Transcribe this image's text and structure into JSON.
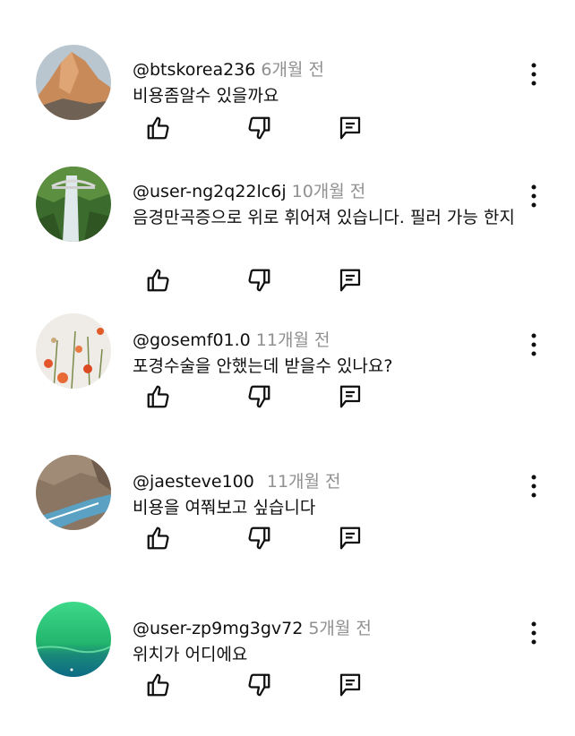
{
  "comments": [
    {
      "handle": "@btskorea236",
      "time": "6개월 전",
      "text": "비용좀알수 있을까요"
    },
    {
      "handle": "@user-ng2q22lc6j",
      "time": "10개월 전",
      "text": "음경만곡증으로 위로 휘어져 있습니다. 필러 가능 한지"
    },
    {
      "handle": "@gosemf01.0",
      "time": "11개월 전",
      "text": "포경수술을 안했는데 받을수 있나요?"
    },
    {
      "handle": "@jaesteve100",
      "time": "11개월 전",
      "text": "비용을 여쭤보고 싶습니다"
    },
    {
      "handle": "@user-zp9mg3gv72",
      "time": "5개월 전",
      "text": "위치가 어디에요"
    }
  ],
  "icons": {
    "like": "thumbs-up-icon",
    "dislike": "thumbs-down-icon",
    "reply": "reply-icon",
    "more": "more-vertical-icon"
  },
  "colors": {
    "text": "#0f0f0f",
    "secondary": "#909090",
    "background": "#ffffff"
  }
}
